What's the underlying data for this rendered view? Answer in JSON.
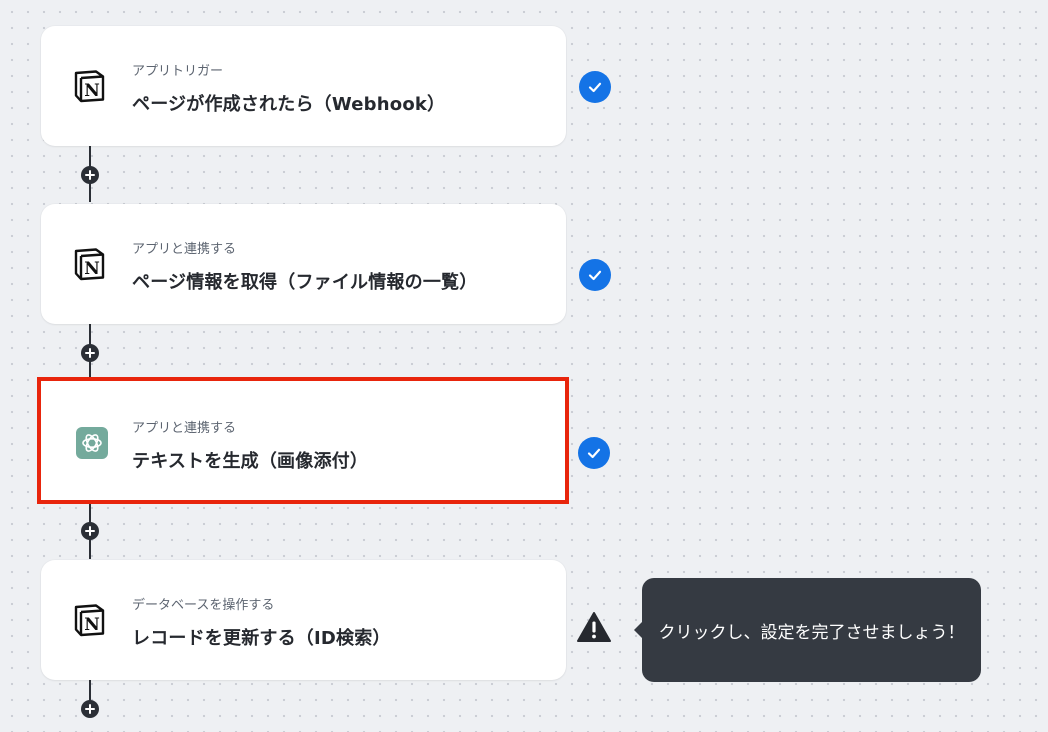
{
  "flow": {
    "steps": [
      {
        "subtitle": "アプリトリガー",
        "title": "ページが作成されたら（Webhook）",
        "app_icon": "notion-icon",
        "status": "completed"
      },
      {
        "subtitle": "アプリと連携する",
        "title": "ページ情報を取得（ファイル情報の一覧）",
        "app_icon": "notion-icon",
        "status": "completed"
      },
      {
        "subtitle": "アプリと連携する",
        "title": "テキストを生成（画像添付）",
        "app_icon": "openai-icon",
        "status": "completed",
        "highlighted": true
      },
      {
        "subtitle": "データベースを操作する",
        "title": "レコードを更新する（ID検索）",
        "app_icon": "notion-icon",
        "status": "warning"
      }
    ],
    "add_step_icon": "plus-icon"
  },
  "tooltip": {
    "text": "クリックし、設定を完了させましょう！"
  },
  "colors": {
    "check": "#1473e6",
    "highlight_border": "#e8250c",
    "connector": "#2b2f36",
    "tooltip_bg": "#353a42",
    "openai_bg": "#74aa9c"
  }
}
